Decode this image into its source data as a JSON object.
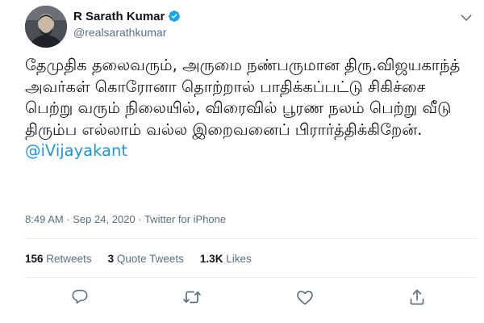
{
  "author": {
    "name": "R Sarath Kumar",
    "handle": "@realsarathkumar",
    "verified_icon": "verified-badge-icon"
  },
  "tweet": {
    "text_before_mention": "தேமுதிக தலைவரும், அருமை நண்பருமான திரு.விஜயகாந்த் அவர்கள் கொரோனா தொற்றால் பாதிக்கப்பட்டு சிகிச்சை பெற்று வரும் நிலையில், விரைவில் பூரண நலம் பெற்று வீடு திரும்ப எல்லாம் வல்ல இறைவனைப் பிரார்த்திக்கிறேன்.",
    "mention": "@iVijayakant"
  },
  "meta": {
    "time": "8:49 AM",
    "separator1": " · ",
    "date": "Sep 24, 2020",
    "separator2": " · ",
    "source": "Twitter for iPhone"
  },
  "stats": {
    "retweets_count": "156",
    "retweets_label": "Retweets",
    "quote_count": "3",
    "quote_label": "Quote Tweets",
    "likes_count": "1.3K",
    "likes_label": "Likes"
  },
  "colors": {
    "mention": "#1b95e0",
    "verified": "#1da1f2",
    "muted": "#5b7083",
    "divider": "#e6ecf0"
  },
  "icons": [
    "chevron-down-icon",
    "reply-icon",
    "retweet-icon",
    "like-icon",
    "share-icon"
  ]
}
